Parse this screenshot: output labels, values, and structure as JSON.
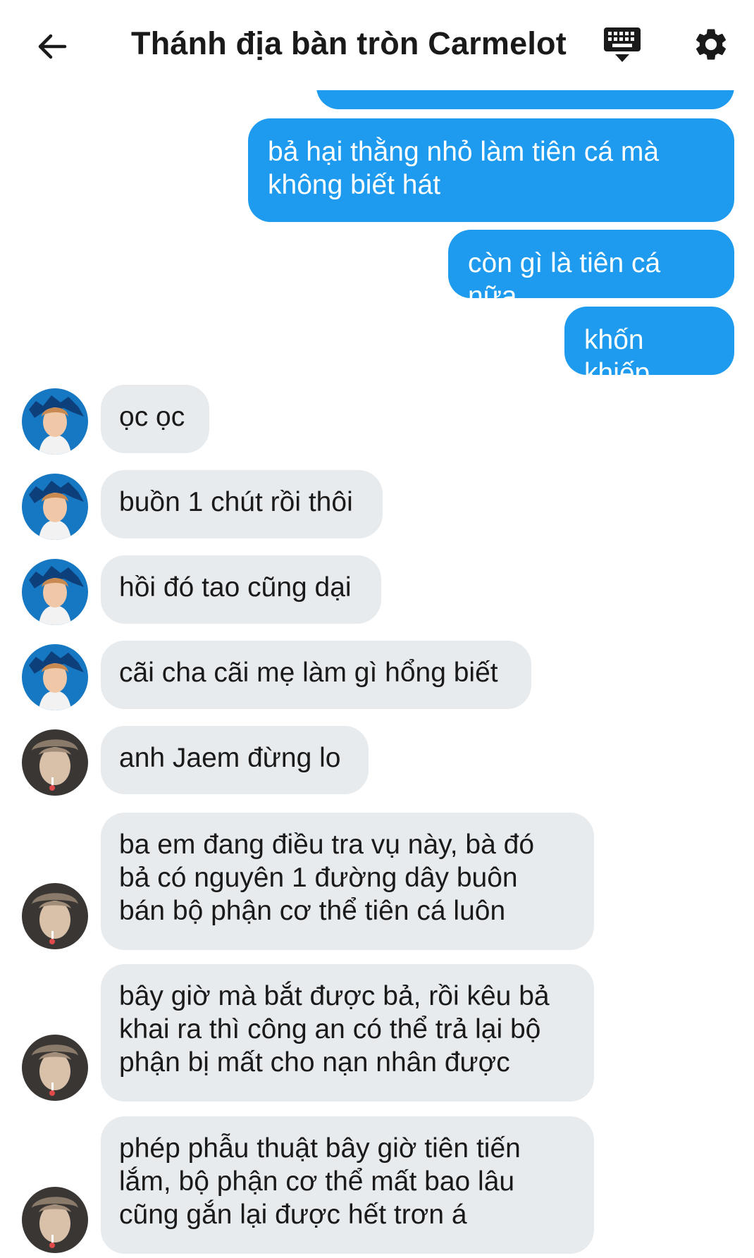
{
  "header": {
    "title": "Thánh địa bàn tròn Carmelot",
    "back_icon": "arrow-left-icon",
    "keyboard_icon": "keyboard-icon",
    "settings_icon": "gear-icon"
  },
  "colors": {
    "outgoing_bubble": "#1e9bef",
    "incoming_bubble": "#e8ebee"
  },
  "messages": {
    "out_1": "bả hại thằng nhỏ làm tiên cá mà\nkhông biết hát",
    "out_2": "còn gì là tiên cá nữa",
    "out_3": "khốn khiếp",
    "in_1": "ọc ọc",
    "in_2": "buồn 1 chút rồi thôi",
    "in_3": "hồi đó tao cũng dại",
    "in_4": "cãi cha cãi mẹ làm gì hổng biết",
    "in_5": "anh Jaem đừng lo",
    "in_6": "ba em đang điều tra vụ này, bà đó\nbả có nguyên 1 đường dây buôn\nbán bộ phận cơ thể tiên cá luôn",
    "in_7": "bây giờ mà bắt được bả, rồi kêu bả\nkhai ra thì công an có thể trả lại bộ\nphận bị mất cho nạn nhân được",
    "in_8": "phép phẫu thuật bây giờ tiên tiến\nlắm, bộ phận cơ thể mất bao lâu\ncũng gắn lại được hết trơn á"
  }
}
